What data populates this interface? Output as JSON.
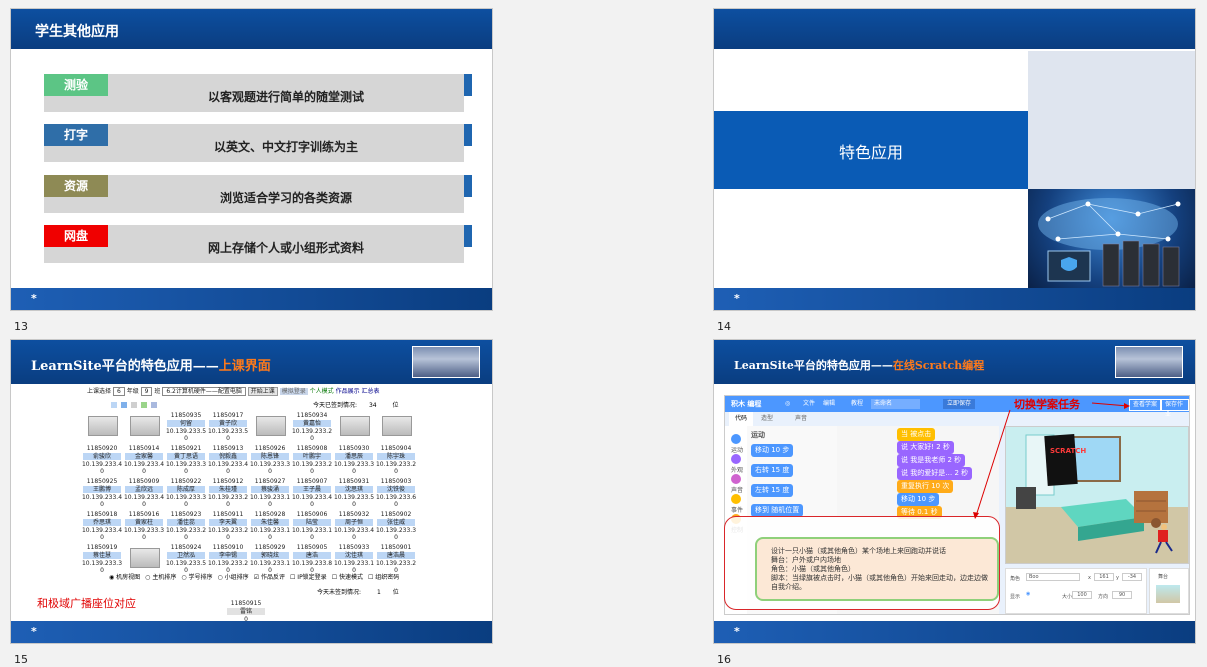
{
  "slides": [
    {
      "number": "13",
      "title": "学生其他应用",
      "footer_mark": "*",
      "rows": [
        {
          "tag": "测验",
          "text": "以客观题进行简单的随堂测试",
          "color": "#5cc585"
        },
        {
          "tag": "打字",
          "text": "以英文、中文打字训练为主",
          "color": "#2f6ea8"
        },
        {
          "tag": "资源",
          "text": "浏览适合学习的各类资源",
          "color": "#8e8a55"
        },
        {
          "tag": "网盘",
          "text": "网上存储个人或小组形式资料",
          "color": "#f00000"
        }
      ]
    },
    {
      "number": "14",
      "title": "特色应用",
      "footer_mark": "*"
    },
    {
      "number": "15",
      "title_main": "LearnSite平台的特色应用——",
      "title_accent": "上课界面",
      "footer_mark": "*",
      "toolbar": {
        "grade_label": "上课选择",
        "grade_value": "6",
        "year_label": "年级",
        "year_value": "9",
        "class_label": "班",
        "class_value": "6.2计算机硬件——配置电脑",
        "start_button": "开始上课",
        "stop_button": "模拟登录",
        "mode1": "个人模式",
        "mode2": "作品展示",
        "mode3": "汇总表"
      },
      "signed_label": "今天已签到情况:",
      "signed_count": "34",
      "signed_unit": "位",
      "unsigned_label": "今天未签到情况:",
      "unsigned_count": "1",
      "unsigned_unit": "位",
      "radio_options": [
        "机房视图",
        "主机排序",
        "学号排序",
        "小组排序",
        "作品反评",
        "IP锁定登录",
        "快速模式",
        "组织密码"
      ],
      "annotation": "和极域广播座位对应",
      "absent": {
        "id": "11850915",
        "name": "雷铭",
        "score": "0"
      },
      "seats": [
        {
          "id": "11850935",
          "name": "何留",
          "ip": "10.139.233.5",
          "s": "0"
        },
        {
          "id": "11850917",
          "name": "黄子欣",
          "ip": "10.139.233.5",
          "s": "0"
        },
        {
          "id": "11850934",
          "name": "黄嘉怡",
          "ip": "10.139.233.2",
          "s": "0"
        },
        {
          "id": "11850920",
          "name": "俞骏欣",
          "ip": "10.139.233.4",
          "s": "0"
        },
        {
          "id": "11850914",
          "name": "金家馨",
          "ip": "10.139.233.4",
          "s": "0"
        },
        {
          "id": "11850921",
          "name": "黄丁思语",
          "ip": "10.139.233.3",
          "s": "0"
        },
        {
          "id": "11850913",
          "name": "倪毅鑫",
          "ip": "10.139.233.4",
          "s": "0"
        },
        {
          "id": "11850926",
          "name": "陈恩锋",
          "ip": "10.139.233.3",
          "s": "0"
        },
        {
          "id": "11850908",
          "name": "叶鹏宇",
          "ip": "10.139.233.2",
          "s": "0"
        },
        {
          "id": "11850930",
          "name": "潘思辰",
          "ip": "10.139.233.3",
          "s": "0"
        },
        {
          "id": "11850904",
          "name": "陈宇珠",
          "ip": "10.139.233.2",
          "s": "0"
        },
        {
          "id": "11850925",
          "name": "王鹏博",
          "ip": "10.139.233.4",
          "s": "0"
        },
        {
          "id": "11850909",
          "name": "孟欣远",
          "ip": "10.139.233.4",
          "s": "0"
        },
        {
          "id": "11850922",
          "name": "陈成厚",
          "ip": "10.139.233.3",
          "s": "0"
        },
        {
          "id": "11850912",
          "name": "朱桂瑾",
          "ip": "10.139.233.2",
          "s": "0"
        },
        {
          "id": "11850927",
          "name": "蔡骏涌",
          "ip": "10.139.233.1",
          "s": "0"
        },
        {
          "id": "11850907",
          "name": "王子晨",
          "ip": "10.139.233.4",
          "s": "0"
        },
        {
          "id": "11850931",
          "name": "沈思琪",
          "ip": "10.139.233.5",
          "s": "0"
        },
        {
          "id": "11850903",
          "name": "沈铁俊",
          "ip": "10.139.233.6",
          "s": "0"
        },
        {
          "id": "11850918",
          "name": "乔思琪",
          "ip": "10.139.233.4",
          "s": "0"
        },
        {
          "id": "11850916",
          "name": "黄家柱",
          "ip": "10.139.233.3",
          "s": "0"
        },
        {
          "id": "11850923",
          "name": "潘佳蕊",
          "ip": "10.139.233.2",
          "s": "0"
        },
        {
          "id": "11850911",
          "name": "李天翼",
          "ip": "10.139.233.2",
          "s": "0"
        },
        {
          "id": "11850928",
          "name": "朱佳馨",
          "ip": "10.139.233.1",
          "s": "0"
        },
        {
          "id": "11850906",
          "name": "陆莹",
          "ip": "10.139.233.1",
          "s": "0"
        },
        {
          "id": "11850932",
          "name": "周子恒",
          "ip": "10.139.233.4",
          "s": "0"
        },
        {
          "id": "11850902",
          "name": "张佳威",
          "ip": "10.139.233.3",
          "s": "0"
        },
        {
          "id": "11850919",
          "name": "蔡佳慧",
          "ip": "10.139.233.3",
          "s": "0"
        },
        {
          "id": "11850924",
          "name": "卫然泓",
          "ip": "10.139.233.5",
          "s": "0"
        },
        {
          "id": "11850910",
          "name": "李申锡",
          "ip": "10.139.233.2",
          "s": "0"
        },
        {
          "id": "11850929",
          "name": "郭晓炫",
          "ip": "10.139.233.1",
          "s": "0"
        },
        {
          "id": "11850905",
          "name": "唐浩",
          "ip": "10.139.233.8",
          "s": "0"
        },
        {
          "id": "11850933",
          "name": "沈佳琪",
          "ip": "10.139.233.1",
          "s": "0"
        },
        {
          "id": "11850901",
          "name": "唐浩晨",
          "ip": "10.139.233.2",
          "s": "0"
        }
      ]
    },
    {
      "number": "16",
      "title_main": "LearnSite平台的特色应用——",
      "title_accent": "在线Scratch编程",
      "footer_mark": "*",
      "switch_label": "切换学案任务",
      "scratch": {
        "logo": "积木 编程",
        "menu": [
          "文件",
          "编辑",
          "教程"
        ],
        "project_name": "未命名",
        "share_button": "立即保存",
        "btn_task": "查看学案",
        "btn_switch": "保存作业",
        "tabs": [
          "代码",
          "造型",
          "声音"
        ],
        "category_title": "运动",
        "categories": [
          {
            "label": "运动",
            "color": "#4c97ff"
          },
          {
            "label": "外观",
            "color": "#9966ff"
          },
          {
            "label": "声音",
            "color": "#cf63cf"
          },
          {
            "label": "事件",
            "color": "#ffbf00"
          },
          {
            "label": "控制",
            "color": "#ffab19"
          }
        ],
        "palette_blocks": [
          {
            "text": "移动 10 步",
            "color": "#4c97ff"
          },
          {
            "text": "右转 15 度",
            "color": "#4c97ff"
          },
          {
            "text": "左转 15 度",
            "color": "#4c97ff"
          },
          {
            "text": "移到 随机位置",
            "color": "#4c97ff"
          }
        ],
        "script_blocks": [
          {
            "text": "当 被点击",
            "color": "#ffbf00"
          },
          {
            "text": "说 大家好! 2 秒",
            "color": "#9966ff"
          },
          {
            "text": "说 我是我老师 2 秒",
            "color": "#9966ff"
          },
          {
            "text": "说 我的爱好是… 2 秒",
            "color": "#9966ff"
          },
          {
            "text": "重复执行 10 次",
            "color": "#ffab19"
          },
          {
            "text": "移动 10 步",
            "color": "#4c97ff"
          },
          {
            "text": "等待 0.1 秒",
            "color": "#ffab19"
          }
        ],
        "task_lines": [
          "设计一只小猫（或其他角色）某个场地上来回跑动并说话",
          "舞台：户外或户内场地",
          "角色：小猫（或其他角色）",
          "脚本：当绿旗被点击时，小猫（或其他角色）开始来回走动，边走边做自我介绍。"
        ],
        "sprite_label": "角色",
        "sprite_name": "Boo",
        "x_label": "x",
        "x_value": "161",
        "y_label": "y",
        "y_value": "-34",
        "show_label": "显示",
        "size_label": "大小",
        "size_value": "100",
        "dir_label": "方向",
        "dir_value": "90",
        "stage_label": "舞台",
        "poster_text": "SCRATCH"
      }
    }
  ]
}
